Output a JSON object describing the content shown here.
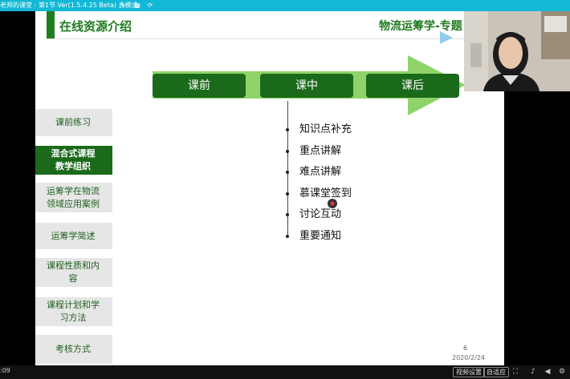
{
  "titlebar": {
    "title": "老师的课堂 - 第1节 Ver(1.5.4.25 Beta)  云模式"
  },
  "slide": {
    "title": "在线资源介绍",
    "subject": "物流运筹学-专题",
    "phases": [
      "课前",
      "课中",
      "课后"
    ],
    "items": [
      "知识点补充",
      "重点讲解",
      "难点讲解",
      "慕课堂签到",
      "讨论互动",
      "重要通知"
    ],
    "nav": [
      {
        "label": "课前练习"
      },
      {
        "label": "混合式课程\n教学组织"
      },
      {
        "label": "运筹学在物流\n领域应用案例"
      },
      {
        "label": "运筹学简述"
      },
      {
        "label": "课程性质和内\n容"
      },
      {
        "label": "课程计划和学\n习方法"
      },
      {
        "label": "考核方式"
      }
    ],
    "page_number": "6",
    "date": "2020/2/24"
  },
  "bottombar": {
    "time": ":09",
    "btn_video_settings": "视频设置",
    "btn_self_adapt": "自适应"
  },
  "colors": {
    "accent_green": "#1b6a1b",
    "arrow_green": "#8fd36a",
    "titlebar": "#12b8d6"
  },
  "icons": {
    "titlebar": [
      "edit-icon",
      "grid-icon",
      "refresh-icon"
    ],
    "bottombar": [
      "fullscreen-icon",
      "mic-icon",
      "volume-icon",
      "settings-icon"
    ]
  }
}
